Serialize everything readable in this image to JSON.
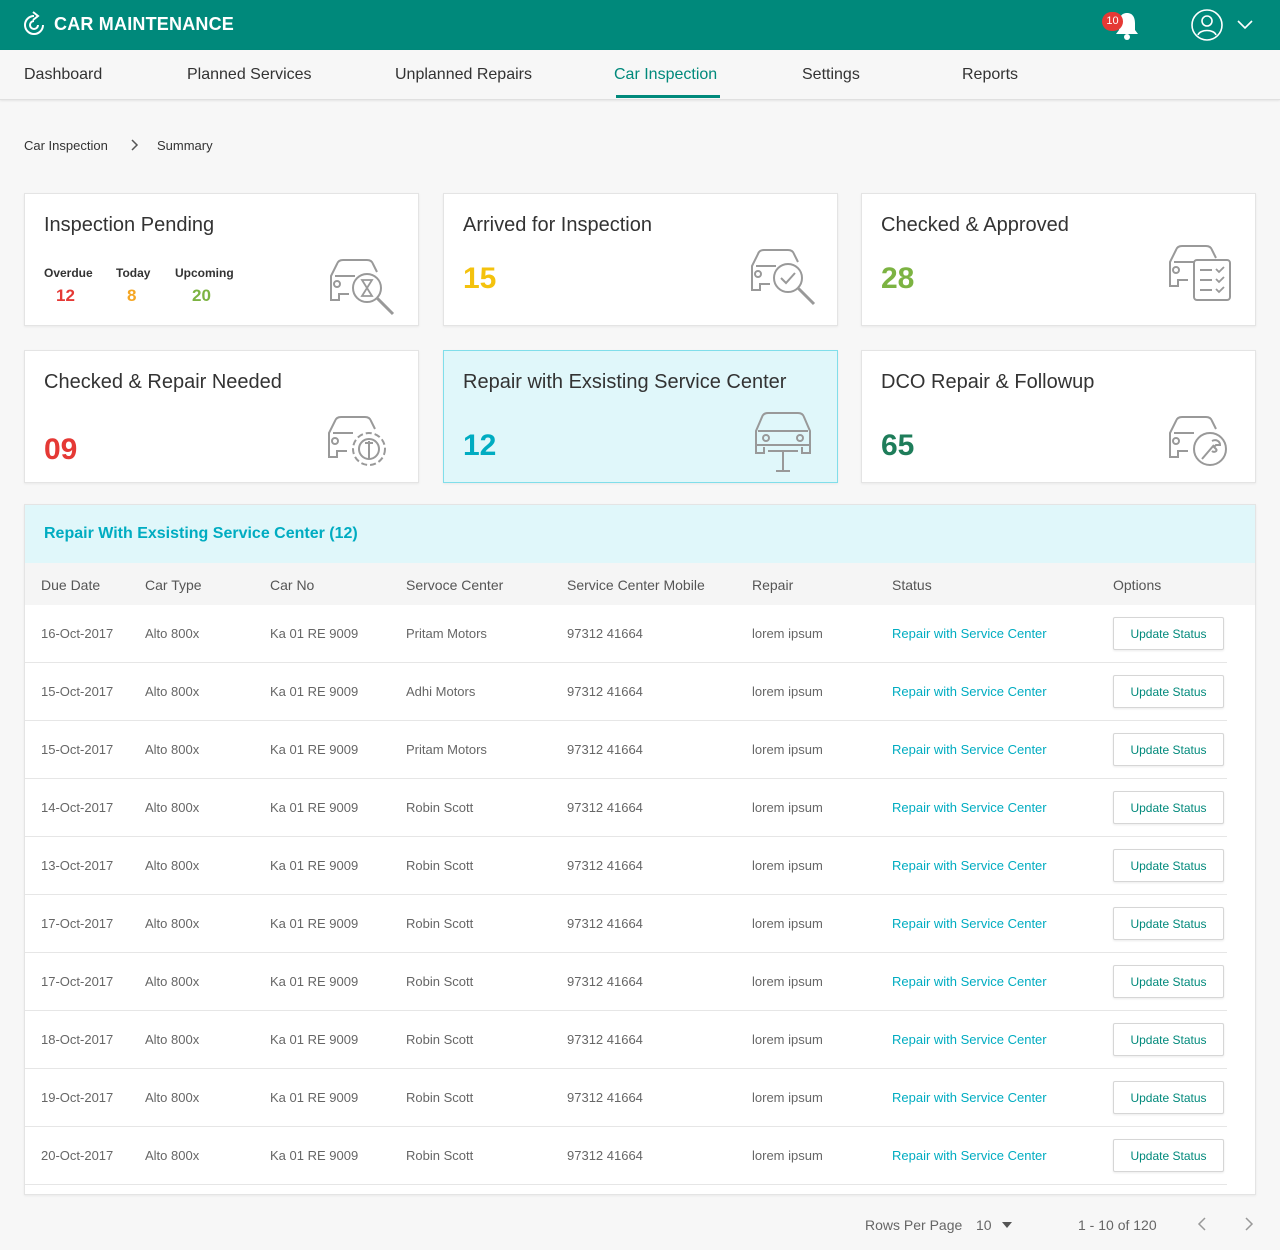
{
  "header": {
    "title": "CAR MAINTENANCE",
    "notification_count": "10"
  },
  "nav": {
    "items": [
      {
        "label": "Dashboard"
      },
      {
        "label": "Planned Services"
      },
      {
        "label": "Unplanned Repairs"
      },
      {
        "label": "Car Inspection"
      },
      {
        "label": "Settings"
      },
      {
        "label": "Reports"
      }
    ],
    "active": "Car Inspection"
  },
  "breadcrumb": {
    "parent": "Car Inspection",
    "current": "Summary"
  },
  "cards": {
    "pending": {
      "title": "Inspection Pending",
      "overdue_label": "Overdue",
      "overdue_value": "12",
      "today_label": "Today",
      "today_value": "8",
      "upcoming_label": "Upcoming",
      "upcoming_value": "20"
    },
    "arrived": {
      "title": "Arrived for Inspection",
      "value": "15"
    },
    "approved": {
      "title": "Checked & Approved",
      "value": "28"
    },
    "repair_needed": {
      "title": "Checked & Repair Needed",
      "value": "09"
    },
    "existing_center": {
      "title": "Repair with Exsisting Service Center",
      "value": "12"
    },
    "dco": {
      "title": "DCO Repair & Followup",
      "value": "65"
    }
  },
  "colors": {
    "brand": "#00897b",
    "accent": "#00acc1",
    "red": "#e53935",
    "orange": "#f5a623",
    "green": "#7cb342",
    "yellow": "#f4c20d",
    "dark_green": "#1e7d5a"
  },
  "table": {
    "title": "Repair With Exsisting Service Center (12)",
    "columns": [
      "Due Date",
      "Car Type",
      "Car No",
      "Servoce Center",
      "Service Center Mobile",
      "Repair",
      "Status",
      "Options"
    ],
    "rows": [
      {
        "due": "16-Oct-2017",
        "type": "Alto 800x",
        "no": "Ka 01 RE 9009",
        "center": "Pritam Motors",
        "mobile": "97312 41664",
        "repair": "lorem ipsum",
        "status": "Repair with Service Center",
        "option": "Update Status"
      },
      {
        "due": "15-Oct-2017",
        "type": "Alto 800x",
        "no": "Ka 01 RE 9009",
        "center": "Adhi Motors",
        "mobile": "97312 41664",
        "repair": "lorem ipsum",
        "status": "Repair with Service Center",
        "option": "Update Status"
      },
      {
        "due": "15-Oct-2017",
        "type": "Alto 800x",
        "no": "Ka 01 RE 9009",
        "center": "Pritam Motors",
        "mobile": "97312 41664",
        "repair": "lorem ipsum",
        "status": "Repair with Service Center",
        "option": "Update Status"
      },
      {
        "due": "14-Oct-2017",
        "type": "Alto 800x",
        "no": "Ka 01 RE 9009",
        "center": "Robin Scott",
        "mobile": "97312 41664",
        "repair": "lorem ipsum",
        "status": "Repair with Service Center",
        "option": "Update Status"
      },
      {
        "due": "13-Oct-2017",
        "type": "Alto 800x",
        "no": "Ka 01 RE 9009",
        "center": "Robin Scott",
        "mobile": "97312 41664",
        "repair": "lorem ipsum",
        "status": "Repair with Service Center",
        "option": "Update Status"
      },
      {
        "due": "17-Oct-2017",
        "type": "Alto 800x",
        "no": "Ka 01 RE 9009",
        "center": "Robin Scott",
        "mobile": "97312 41664",
        "repair": "lorem ipsum",
        "status": "Repair with Service Center",
        "option": "Update Status"
      },
      {
        "due": "17-Oct-2017",
        "type": "Alto 800x",
        "no": "Ka 01 RE 9009",
        "center": "Robin Scott",
        "mobile": "97312 41664",
        "repair": "lorem ipsum",
        "status": "Repair with Service Center",
        "option": "Update Status"
      },
      {
        "due": "18-Oct-2017",
        "type": "Alto 800x",
        "no": "Ka 01 RE 9009",
        "center": "Robin Scott",
        "mobile": "97312 41664",
        "repair": "lorem ipsum",
        "status": "Repair with Service Center",
        "option": "Update Status"
      },
      {
        "due": "19-Oct-2017",
        "type": "Alto 800x",
        "no": "Ka 01 RE 9009",
        "center": "Robin Scott",
        "mobile": "97312 41664",
        "repair": "lorem ipsum",
        "status": "Repair with Service Center",
        "option": "Update Status"
      },
      {
        "due": "20-Oct-2017",
        "type": "Alto 800x",
        "no": "Ka 01 RE 9009",
        "center": "Robin Scott",
        "mobile": "97312 41664",
        "repair": "lorem ipsum",
        "status": "Repair with Service Center",
        "option": "Update Status"
      }
    ]
  },
  "pagination": {
    "rows_label": "Rows Per Page",
    "rows_value": "10",
    "range": "1 - 10 of 120"
  }
}
